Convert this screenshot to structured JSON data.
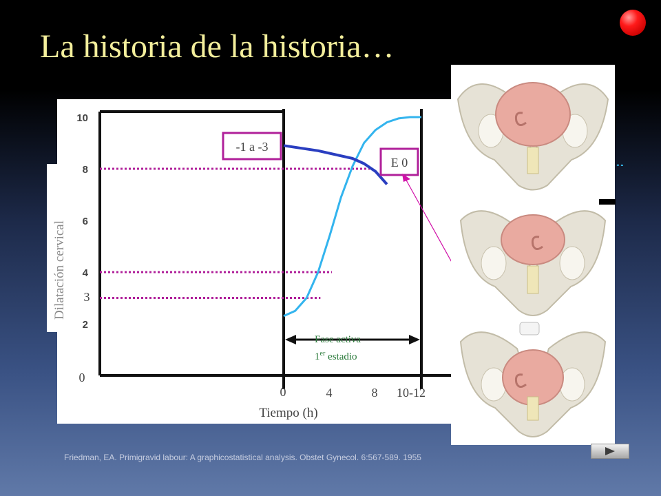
{
  "slide": {
    "title": "La historia de la historia…",
    "citation": "Friedman, EA. Primigravid labour: A graphicostatistical analysis. Obstet Gynecol. 6:567-589. 1955"
  },
  "colors": {
    "curve": "#33b4ee",
    "descent": "#2a3ec0",
    "guides": "#b0209a",
    "title": "#f4ef9c",
    "annotation_text": "#2a7a3a"
  },
  "chart_data": {
    "type": "line",
    "xlabel": "Tiempo (h)",
    "ylabel": "Dilatación cervical",
    "ylim": [
      0,
      10
    ],
    "x_tick_labels": [
      "0",
      "4",
      "8",
      "10-12"
    ],
    "y_tick_labels": [
      "10",
      "8",
      "6",
      "4",
      "3",
      "2",
      "0"
    ],
    "grid": false,
    "series": [
      {
        "role": "dilatación",
        "x": [
          0,
          1,
          2,
          3,
          4,
          5,
          6,
          7,
          8,
          9,
          10,
          11,
          12
        ],
        "y": [
          2.3,
          2.5,
          3,
          4,
          5.4,
          6.9,
          8.1,
          9,
          9.5,
          9.8,
          9.95,
          10,
          10
        ]
      },
      {
        "role": "descenso",
        "x": [
          0,
          3,
          6,
          7,
          8,
          9
        ],
        "y": [
          8.9,
          8.7,
          8.4,
          8.2,
          7.9,
          7.4
        ]
      }
    ],
    "reference_lines": [
      {
        "y": 8,
        "x_end": 7.5
      },
      {
        "y": 4,
        "x_end": 4.2
      },
      {
        "y": 3,
        "x_end": 3.2
      }
    ],
    "vertical_markers": [
      0,
      12
    ],
    "annotations": {
      "station_start": "-1 a -3",
      "station_end": "E 0",
      "phase_line1": "Fase activa",
      "phase_line2_main": "1",
      "phase_line2_sup": "er",
      "phase_line2_rest": " estadio",
      "y_minor_label": "3",
      "y_origin_label": "0",
      "x_origin_label": "0"
    }
  },
  "navigation": {
    "next_icon": "play-icon"
  }
}
